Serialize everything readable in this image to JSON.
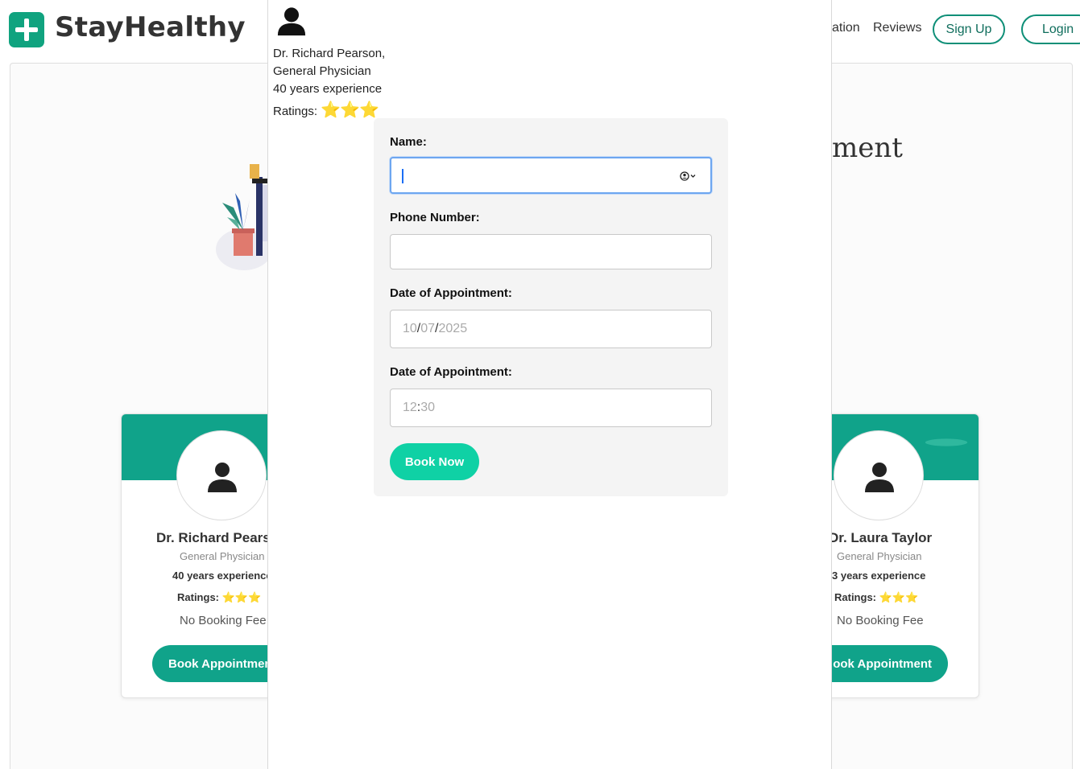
{
  "navbar": {
    "brand": "StayHealthy",
    "links": [
      "ation",
      "Reviews"
    ],
    "signup_label": "Sign Up",
    "login_label": "Login"
  },
  "page": {
    "heading_fragment": "ment"
  },
  "cards": [
    {
      "name": "Dr. Richard Pearso",
      "speciality": "General Physician",
      "experience": "40 years experience",
      "ratings_label": "Ratings:",
      "stars": "⭐⭐⭐",
      "fee": "No Booking Fee",
      "button": "Book Appointmen"
    },
    {
      "name": "Dr. Laura Taylor",
      "speciality": "General Physician",
      "experience": "3 years experience",
      "ratings_label": "Ratings:",
      "stars": "⭐⭐⭐",
      "fee": "No Booking Fee",
      "button": "ook Appointment"
    }
  ],
  "modal": {
    "doctor_name": "Dr. Richard Pearson,",
    "speciality": "General Physician",
    "experience": "40 years experience",
    "ratings_label": "Ratings:",
    "stars": "⭐⭐⭐",
    "form": {
      "name_label": "Name:",
      "name_value": "",
      "phone_label": "Phone Number:",
      "phone_value": "",
      "date_label": "Date of Appointment:",
      "date_parts": [
        "10",
        "07",
        "2025"
      ],
      "date_separator": "/",
      "time_label": "Date of Appointment:",
      "time_parts": [
        "12",
        "30"
      ],
      "time_separator": ":",
      "submit_label": "Book Now"
    }
  },
  "colors": {
    "brand_green": "#10a37f",
    "card_band": "#10a38a",
    "submit_button": "#0fd1a5",
    "focus_ring": "#6da6f0"
  },
  "icons": [
    "plus-logo-icon",
    "user-avatar-icon",
    "autofill-contact-icon",
    "star-icon"
  ]
}
